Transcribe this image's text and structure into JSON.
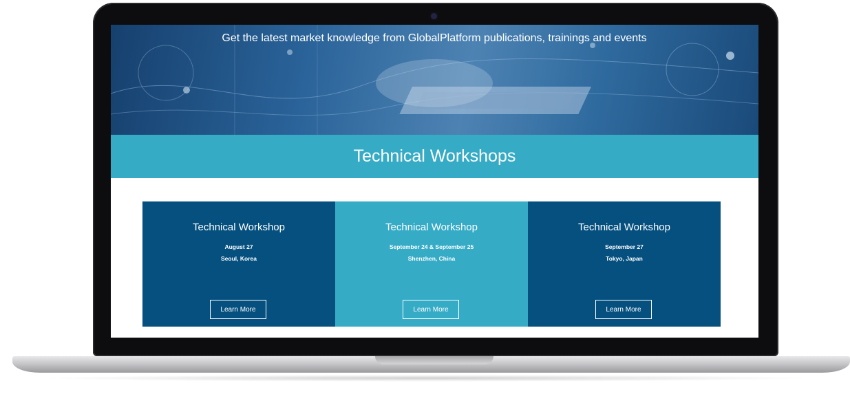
{
  "hero": {
    "text": "Get the latest market knowledge from GlobalPlatform publications, trainings and events"
  },
  "section": {
    "title": "Technical Workshops"
  },
  "cards": [
    {
      "title": "Technical Workshop",
      "date": "August 27",
      "location": "Seoul, Korea",
      "button": "Learn More"
    },
    {
      "title": "Technical Workshop",
      "date": "September 24 & September 25",
      "location": "Shenzhen, China",
      "button": "Learn More"
    },
    {
      "title": "Technical Workshop",
      "date": "September 27",
      "location": "Tokyo, Japan",
      "button": "Learn More"
    }
  ],
  "colors": {
    "hero_blue": "#2a6399",
    "band_teal": "#35abc6",
    "card_dark": "#06507f",
    "card_light": "#35abc6"
  }
}
